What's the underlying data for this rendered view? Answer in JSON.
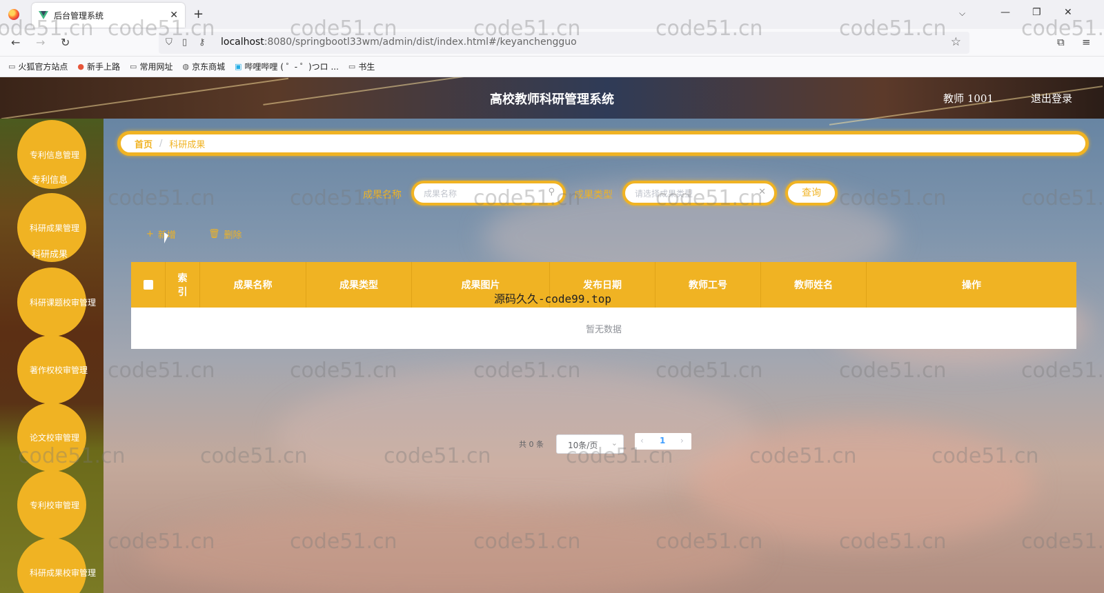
{
  "browser": {
    "tab_title": "后台管理系统",
    "tab_close": "✕",
    "new_tab": "+",
    "tab_list": "⌵",
    "win_minimize": "—",
    "win_restore": "❐",
    "win_close": "✕",
    "url_host": "localhost",
    "url_rest": ":8080/springbootl33wm/admin/dist/index.html#/keyanchengguo",
    "bookmarks": [
      "火狐官方站点",
      "新手上路",
      "常用网址",
      "京东商城",
      "哔哩哔哩 ( ゜- ゜)つロ ...",
      "书生"
    ]
  },
  "header": {
    "title": "高校教师科研管理系统",
    "user": "教师 1001",
    "logout": "退出登录"
  },
  "sidebar": {
    "menus": [
      {
        "title": "专利信息管理",
        "sub": "专利信息"
      },
      {
        "title": "科研成果管理",
        "sub": "科研成果"
      },
      {
        "title": "科研课题校审管理",
        "sub": ""
      },
      {
        "title": "著作权校审管理",
        "sub": ""
      },
      {
        "title": "论文校审管理",
        "sub": ""
      },
      {
        "title": "专利校审管理",
        "sub": ""
      },
      {
        "title": "科研成果校审管理",
        "sub": ""
      }
    ]
  },
  "breadcrumb": {
    "home": "首页",
    "sep": "/",
    "current": "科研成果"
  },
  "search": {
    "name_label": "成果名称",
    "name_placeholder": "成果名称",
    "type_label": "成果类型",
    "type_placeholder": "请选择成果类型",
    "query_button": "查询"
  },
  "actions": {
    "add": "新增",
    "delete": "删除"
  },
  "table": {
    "columns": [
      "索引",
      "成果名称",
      "成果类型",
      "成果图片",
      "发布日期",
      "教师工号",
      "教师姓名",
      "操作"
    ],
    "empty_text": "暂无数据"
  },
  "watermark_center": "源码久久-code99.top",
  "watermark": "code51.cn",
  "pagination": {
    "total": "共 0 条",
    "page_size": "10条/页",
    "current_page": "1"
  },
  "colors": {
    "accent": "#f0b323",
    "header_text": "#ffffff"
  }
}
